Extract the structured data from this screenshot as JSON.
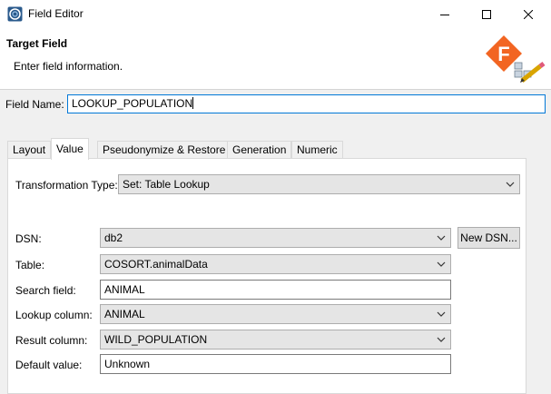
{
  "window": {
    "title": "Field Editor",
    "icon": "app-logo-icon"
  },
  "header": {
    "title": "Target Field",
    "description": "Enter field information."
  },
  "field_name": {
    "label": "Field Name:",
    "value": "LOOKUP_POPULATION"
  },
  "tabs": [
    {
      "label": "Layout",
      "active": false
    },
    {
      "label": "Value",
      "active": true
    },
    {
      "label": "Pseudonymize & Restore",
      "active": false
    },
    {
      "label": "Generation",
      "active": false
    },
    {
      "label": "Numeric",
      "active": false
    }
  ],
  "value_tab": {
    "transformation_type": {
      "label": "Transformation Type:",
      "value": "Set: Table Lookup"
    },
    "dsn": {
      "label": "DSN:",
      "value": "db2"
    },
    "new_dsn_button": "New DSN...",
    "table": {
      "label": "Table:",
      "value": "COSORT.animalData"
    },
    "search_field": {
      "label": "Search field:",
      "value": "ANIMAL"
    },
    "lookup_column": {
      "label": "Lookup column:",
      "value": "ANIMAL"
    },
    "result_column": {
      "label": "Result column:",
      "value": "WILD_POPULATION"
    },
    "default_value": {
      "label": "Default value:",
      "value": "Unknown"
    }
  },
  "colors": {
    "accent": "#0078d7",
    "logo_orange": "#f26522"
  }
}
